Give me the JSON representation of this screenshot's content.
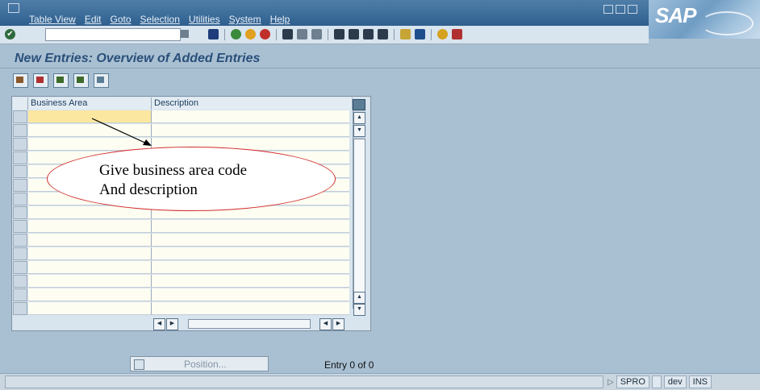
{
  "window": {
    "menu": [
      "Table View",
      "Edit",
      "Goto",
      "Selection",
      "Utilities",
      "System",
      "Help"
    ],
    "brand": "SAP"
  },
  "toolbar": {
    "command_value": "",
    "icons": [
      "enter-icon",
      "back-icon",
      "exit-icon",
      "cancel-icon",
      "print-icon",
      "find-icon",
      "find-next-icon",
      "first-page-icon",
      "previous-page-icon",
      "next-page-icon",
      "last-page-icon",
      "create-session-icon",
      "shortcut-icon",
      "help-icon",
      "layout-icon"
    ]
  },
  "page": {
    "title": "New Entries: Overview of Added Entries"
  },
  "table": {
    "columns": [
      "Business Area",
      "Description"
    ],
    "row_count": 15,
    "rows": []
  },
  "annotation": {
    "line1": "Give business area code",
    "line2": "And description"
  },
  "footer": {
    "position_label": "Position...",
    "entry_text": "Entry 0 of 0"
  },
  "status": {
    "transaction": "SPRO",
    "system": "dev",
    "mode": "INS"
  },
  "colors": {
    "menubar": "#2f5f8e",
    "background": "#a9c0d2",
    "title_text": "#2a4f7a",
    "selected_cell": "#fce7a0",
    "callout_border": "#d12a2a"
  }
}
